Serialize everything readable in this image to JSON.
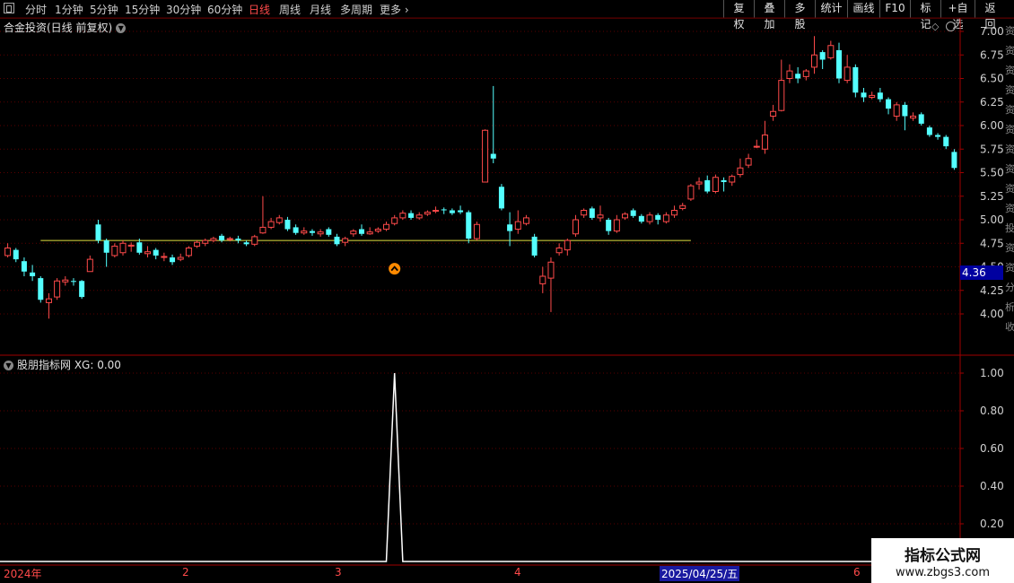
{
  "toolbar": {
    "tabs": [
      "分时",
      "1分钟",
      "5分钟",
      "15分钟",
      "30分钟",
      "60分钟",
      "日线",
      "周线",
      "月线",
      "多周期",
      "更多"
    ],
    "active_tab": "日线",
    "right_buttons": [
      "复权",
      "叠加",
      "多股",
      "统计",
      "画线",
      "F10",
      "标记",
      "+自选",
      "返回"
    ]
  },
  "main_title": "合金投资(日线 前复权)",
  "indicator_title": "股朋指标网 XG: 0.00",
  "current_price_label": "4.36",
  "watermark": {
    "line1": "指标公式网",
    "line2": "www.zbgs3.com"
  },
  "colors": {
    "up": "#ff4a4a",
    "down": "#54ffff",
    "signal_line": "#e0e040",
    "xg_line": "#ffffff",
    "grid": "#5a0000",
    "axis_text": "#d0d0d0"
  },
  "x_axis_labels": [
    {
      "label": "2024年",
      "cursor": false
    },
    {
      "label": "2",
      "cursor": false
    },
    {
      "label": "3",
      "cursor": false
    },
    {
      "label": "4",
      "cursor": false
    },
    {
      "label": "2025/04/25/五",
      "cursor": true
    },
    {
      "label": "6",
      "cursor": false
    }
  ],
  "right_strip_text": "资资资资资资资资资资投资资分析收",
  "chart_data": [
    {
      "type": "candlestick",
      "title": "合金投资(日线 前复权)",
      "y_ticks": [
        4.0,
        4.25,
        4.5,
        4.75,
        5.0,
        5.25,
        5.5,
        5.75,
        6.0,
        6.25,
        6.5,
        6.75,
        7.0
      ],
      "y_tick_labels": [
        "4.00",
        "4.25",
        "4.50",
        "4.75",
        "5.00",
        "5.25",
        "5.50",
        "5.75",
        "6.00",
        "6.25",
        "6.50",
        "6.75",
        "7.00"
      ],
      "ylim": [
        3.6,
        7.1
      ],
      "signal_level": 4.78,
      "signal_marker_index": 47,
      "candles": [
        [
          4.62,
          4.7,
          4.75,
          4.6
        ],
        [
          4.68,
          4.58,
          4.7,
          4.55
        ],
        [
          4.56,
          4.45,
          4.6,
          4.4
        ],
        [
          4.44,
          4.4,
          4.52,
          4.35
        ],
        [
          4.38,
          4.15,
          4.4,
          4.12
        ],
        [
          4.12,
          4.16,
          4.22,
          3.95
        ],
        [
          4.18,
          4.35,
          4.38,
          4.15
        ],
        [
          4.34,
          4.36,
          4.4,
          4.3
        ],
        [
          4.35,
          4.34,
          4.38,
          4.3
        ],
        [
          4.35,
          4.18,
          4.36,
          4.16
        ],
        [
          4.45,
          4.58,
          4.62,
          4.45
        ],
        [
          4.95,
          4.78,
          5.0,
          4.75
        ],
        [
          4.78,
          4.65,
          4.8,
          4.5
        ],
        [
          4.62,
          4.72,
          4.75,
          4.6
        ],
        [
          4.65,
          4.75,
          4.78,
          4.62
        ],
        [
          4.72,
          4.73,
          4.76,
          4.66
        ],
        [
          4.76,
          4.65,
          4.8,
          4.63
        ],
        [
          4.64,
          4.66,
          4.72,
          4.6
        ],
        [
          4.68,
          4.62,
          4.7,
          4.58
        ],
        [
          4.6,
          4.61,
          4.65,
          4.56
        ],
        [
          4.6,
          4.55,
          4.63,
          4.52
        ],
        [
          4.58,
          4.6,
          4.64,
          4.56
        ],
        [
          4.62,
          4.7,
          4.72,
          4.6
        ],
        [
          4.72,
          4.76,
          4.78,
          4.7
        ],
        [
          4.75,
          4.78,
          4.8,
          4.72
        ],
        [
          4.78,
          4.8,
          4.82,
          4.76
        ],
        [
          4.83,
          4.78,
          4.85,
          4.76
        ],
        [
          4.79,
          4.8,
          4.82,
          4.77
        ],
        [
          4.8,
          4.78,
          4.83,
          4.75
        ],
        [
          4.76,
          4.74,
          4.78,
          4.72
        ],
        [
          4.74,
          4.82,
          4.84,
          4.72
        ],
        [
          4.86,
          4.92,
          5.25,
          4.85
        ],
        [
          4.92,
          4.98,
          5.02,
          4.9
        ],
        [
          4.97,
          5.02,
          5.05,
          4.95
        ],
        [
          5.0,
          4.9,
          5.03,
          4.88
        ],
        [
          4.92,
          4.86,
          4.95,
          4.84
        ],
        [
          4.86,
          4.88,
          4.92,
          4.84
        ],
        [
          4.88,
          4.86,
          4.9,
          4.83
        ],
        [
          4.85,
          4.87,
          4.9,
          4.82
        ],
        [
          4.9,
          4.84,
          4.92,
          4.82
        ],
        [
          4.82,
          4.74,
          4.85,
          4.72
        ],
        [
          4.76,
          4.8,
          4.82,
          4.72
        ],
        [
          4.85,
          4.88,
          4.9,
          4.82
        ],
        [
          4.9,
          4.85,
          4.95,
          4.83
        ],
        [
          4.85,
          4.87,
          4.92,
          4.84
        ],
        [
          4.88,
          4.9,
          4.92,
          4.86
        ],
        [
          4.9,
          4.95,
          4.98,
          4.88
        ],
        [
          4.96,
          5.02,
          5.05,
          4.94
        ],
        [
          5.02,
          5.07,
          5.1,
          5.0
        ],
        [
          5.07,
          5.02,
          5.1,
          5.0
        ],
        [
          5.02,
          5.05,
          5.08,
          5.0
        ],
        [
          5.06,
          5.08,
          5.1,
          5.04
        ],
        [
          5.09,
          5.1,
          5.14,
          5.07
        ],
        [
          5.11,
          5.1,
          5.13,
          5.06
        ],
        [
          5.1,
          5.07,
          5.12,
          5.05
        ],
        [
          5.1,
          5.08,
          5.15,
          5.06
        ],
        [
          5.08,
          4.8,
          5.1,
          4.75
        ],
        [
          4.8,
          4.95,
          4.98,
          4.78
        ],
        [
          5.4,
          5.95,
          5.96,
          5.45
        ],
        [
          5.7,
          5.65,
          6.42,
          5.6
        ],
        [
          5.35,
          5.12,
          5.38,
          5.1
        ],
        [
          4.95,
          4.88,
          5.08,
          4.72
        ],
        [
          4.9,
          4.98,
          5.1,
          4.85
        ],
        [
          4.96,
          5.02,
          5.05,
          4.94
        ],
        [
          4.82,
          4.62,
          4.85,
          4.6
        ],
        [
          4.32,
          4.4,
          4.5,
          4.22
        ],
        [
          4.38,
          4.55,
          4.6,
          4.02
        ],
        [
          4.65,
          4.7,
          4.75,
          4.62
        ],
        [
          4.68,
          4.78,
          4.8,
          4.62
        ],
        [
          4.85,
          5.0,
          5.05,
          4.82
        ],
        [
          5.05,
          5.1,
          5.12,
          5.02
        ],
        [
          5.12,
          5.02,
          5.14,
          5.0
        ],
        [
          5.02,
          5.05,
          5.15,
          4.98
        ],
        [
          5.0,
          4.88,
          5.02,
          4.84
        ],
        [
          4.88,
          5.0,
          5.05,
          4.86
        ],
        [
          5.02,
          5.06,
          5.08,
          5.0
        ],
        [
          5.1,
          5.04,
          5.12,
          5.02
        ],
        [
          5.04,
          4.98,
          5.06,
          4.96
        ],
        [
          4.98,
          5.05,
          5.08,
          4.95
        ],
        [
          5.05,
          5.0,
          5.07,
          4.95
        ],
        [
          4.98,
          5.05,
          5.08,
          4.96
        ],
        [
          5.05,
          5.1,
          5.15,
          5.02
        ],
        [
          5.12,
          5.15,
          5.18,
          5.1
        ],
        [
          5.22,
          5.36,
          5.38,
          5.2
        ],
        [
          5.38,
          5.4,
          5.45,
          5.32
        ],
        [
          5.42,
          5.3,
          5.47,
          5.28
        ],
        [
          5.3,
          5.45,
          5.48,
          5.28
        ],
        [
          5.42,
          5.4,
          5.45,
          5.3
        ],
        [
          5.4,
          5.46,
          5.48,
          5.36
        ],
        [
          5.48,
          5.55,
          5.65,
          5.45
        ],
        [
          5.58,
          5.65,
          5.7,
          5.55
        ],
        [
          5.78,
          5.78,
          5.85,
          5.76
        ],
        [
          5.75,
          5.9,
          6.05,
          5.7
        ],
        [
          6.1,
          6.15,
          6.22,
          6.05
        ],
        [
          6.16,
          6.48,
          6.7,
          6.15
        ],
        [
          6.5,
          6.58,
          6.65,
          6.45
        ],
        [
          6.55,
          6.5,
          6.62,
          6.45
        ],
        [
          6.52,
          6.58,
          6.6,
          6.48
        ],
        [
          6.62,
          6.75,
          6.95,
          6.55
        ],
        [
          6.78,
          6.7,
          6.8,
          6.6
        ],
        [
          6.72,
          6.85,
          6.9,
          6.7
        ],
        [
          6.8,
          6.5,
          6.88,
          6.45
        ],
        [
          6.48,
          6.62,
          6.75,
          6.45
        ],
        [
          6.62,
          6.35,
          6.65,
          6.3
        ],
        [
          6.35,
          6.3,
          6.4,
          6.25
        ],
        [
          6.3,
          6.32,
          6.36,
          6.28
        ],
        [
          6.35,
          6.28,
          6.4,
          6.25
        ],
        [
          6.28,
          6.18,
          6.3,
          6.12
        ],
        [
          6.1,
          6.22,
          6.25,
          6.05
        ],
        [
          6.22,
          6.1,
          6.25,
          5.95
        ],
        [
          6.08,
          6.1,
          6.14,
          6.05
        ],
        [
          6.12,
          6.02,
          6.14,
          6.0
        ],
        [
          5.98,
          5.9,
          6.0,
          5.88
        ],
        [
          5.9,
          5.88,
          5.92,
          5.85
        ],
        [
          5.88,
          5.78,
          5.9,
          5.75
        ],
        [
          5.72,
          5.55,
          5.75,
          5.53
        ]
      ]
    },
    {
      "type": "line",
      "title": "XG",
      "y_ticks": [
        0.2,
        0.4,
        0.6,
        0.8,
        1.0
      ],
      "y_tick_labels": [
        "0.20",
        "0.40",
        "0.60",
        "0.80",
        "1.00"
      ],
      "ylim": [
        -0.05,
        1.05
      ],
      "series": [
        {
          "values_spike_index": 47,
          "baseline": 0,
          "peak": 1.0
        }
      ]
    }
  ]
}
